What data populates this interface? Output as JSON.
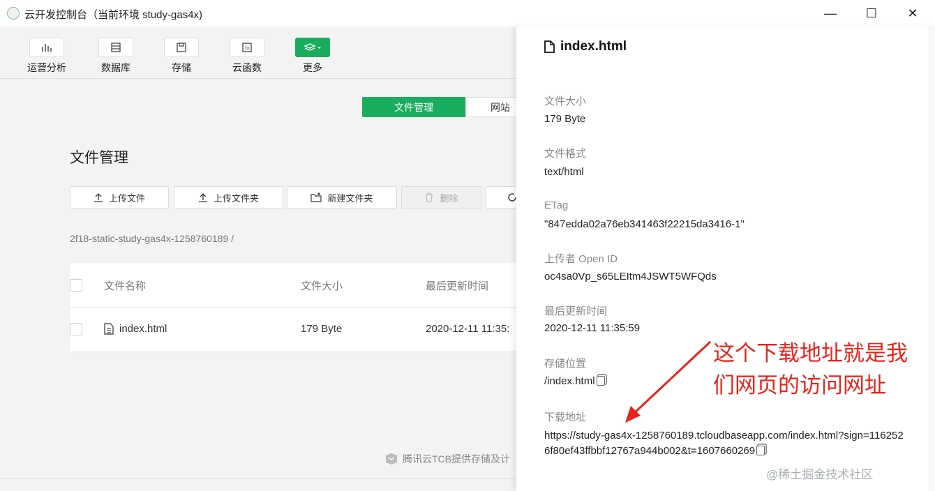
{
  "window": {
    "title": "云开发控制台（当前环境 study-gas4x)",
    "minimize": "—",
    "maximize": "☐",
    "close": "✕"
  },
  "toolbar": {
    "items": [
      {
        "label": "运营分析",
        "icon": "bar-chart-icon"
      },
      {
        "label": "数据库",
        "icon": "database-icon"
      },
      {
        "label": "存储",
        "icon": "save-icon"
      },
      {
        "label": "云函数",
        "icon": "function-icon"
      },
      {
        "label": "更多",
        "icon": "layers-icon"
      }
    ],
    "active_color": "#1aad5f"
  },
  "main": {
    "segments": {
      "active": "文件管理",
      "other": "网站"
    },
    "title": "文件管理",
    "actions": {
      "upload_file": "上传文件",
      "upload_folder": "上传文件夹",
      "new_folder": "新建文件夹",
      "delete": "删除"
    },
    "path": "2f18-static-study-gas4x-1258760189  /",
    "table": {
      "headers": {
        "name": "文件名称",
        "size": "文件大小",
        "updated": "最后更新时间"
      },
      "rows": [
        {
          "name": "index.html",
          "size": "179 Byte",
          "updated": "2020-12-11 11:35:"
        }
      ]
    },
    "footer_note": "腾讯云TCB提供存储及计"
  },
  "panel": {
    "title": "index.html",
    "fields": {
      "size_label": "文件大小",
      "size_value": "179 Byte",
      "format_label": "文件格式",
      "format_value": "text/html",
      "etag_label": "ETag",
      "etag_value": "\"847edda02a76eb341463f22215da3416-1\"",
      "uploader_label": "上传者 Open ID",
      "uploader_value": "oc4sa0Vp_s65LEItm4JSWT5WFQds",
      "updated_label": "最后更新时间",
      "updated_value": "2020-12-11 11:35:59",
      "location_label": "存储位置",
      "location_value": "/index.html",
      "download_label": "下载地址",
      "download_value": "https://study-gas4x-1258760189.tcloudbaseapp.com/index.html?sign=1162526f80ef43ffbbf12767a944b002&t=1607660269"
    }
  },
  "annotation": {
    "line1": "这个下载地址就是我",
    "line2": "们网页的访问网址",
    "color": "#e8231b"
  },
  "watermark": "@稀土掘金技术社区"
}
